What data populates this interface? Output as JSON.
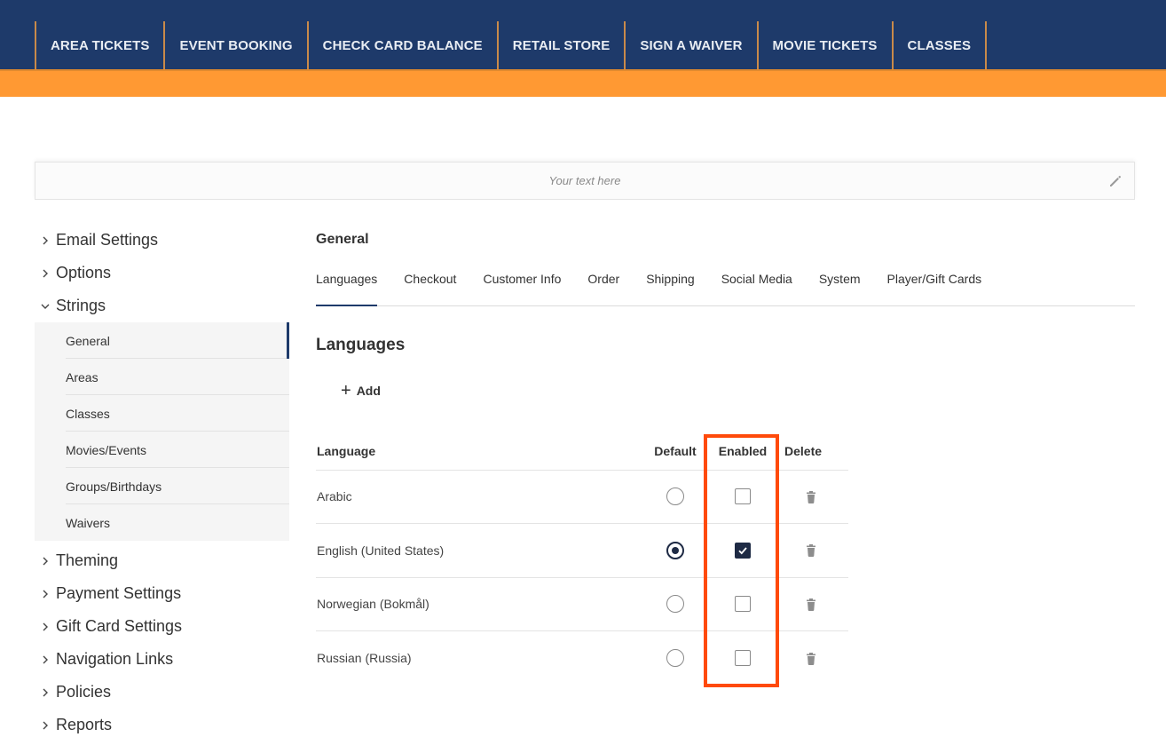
{
  "topnav": {
    "items": [
      "AREA TICKETS",
      "EVENT BOOKING",
      "CHECK CARD BALANCE",
      "RETAIL STORE",
      "SIGN A WAIVER",
      "MOVIE TICKETS",
      "CLASSES"
    ]
  },
  "banner": {
    "placeholder": "Your text here",
    "edit_icon": "pencil-icon"
  },
  "sidebar": {
    "sections_before": [
      {
        "label": "Email Settings",
        "expanded": false
      },
      {
        "label": "Options",
        "expanded": false
      },
      {
        "label": "Strings",
        "expanded": true
      }
    ],
    "sub_items": [
      "General",
      "Areas",
      "Classes",
      "Movies/Events",
      "Groups/Birthdays",
      "Waivers"
    ],
    "active_sub": "General",
    "sections_after": [
      {
        "label": "Theming"
      },
      {
        "label": "Payment Settings"
      },
      {
        "label": "Gift Card Settings"
      },
      {
        "label": "Navigation Links"
      },
      {
        "label": "Policies"
      },
      {
        "label": "Reports"
      }
    ]
  },
  "main": {
    "title": "General",
    "tabs": [
      "Languages",
      "Checkout",
      "Customer Info",
      "Order",
      "Shipping",
      "Social Media",
      "System",
      "Player/Gift Cards"
    ],
    "active_tab": "Languages",
    "languages_title": "Languages",
    "add_label": "Add",
    "table": {
      "headers": {
        "language": "Language",
        "default": "Default",
        "enabled": "Enabled",
        "delete": "Delete"
      },
      "rows": [
        {
          "language": "Arabic",
          "default": false,
          "enabled": false
        },
        {
          "language": "English (United States)",
          "default": true,
          "enabled": true
        },
        {
          "language": "Norwegian (Bokmål)",
          "default": false,
          "enabled": false
        },
        {
          "language": "Russian (Russia)",
          "default": false,
          "enabled": false
        }
      ]
    }
  },
  "colors": {
    "nav_bg": "#1e3a6a",
    "accent_orange": "#ff9933",
    "highlight": "#ff4a0a",
    "checked": "#1e2a44"
  }
}
